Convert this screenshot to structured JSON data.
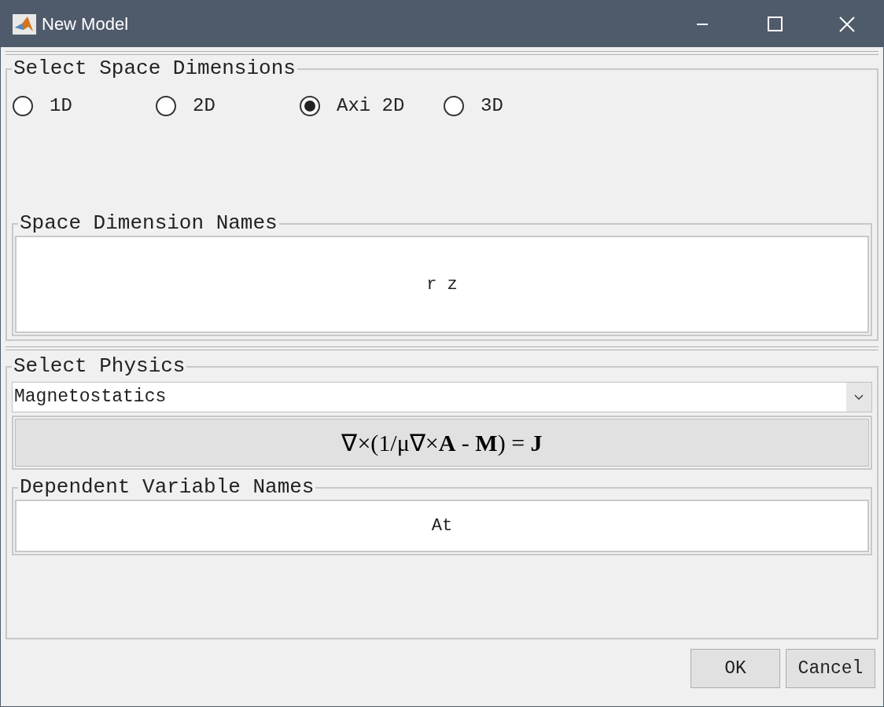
{
  "window": {
    "title": "New Model"
  },
  "space_dimensions": {
    "title": "Select Space Dimensions",
    "options": [
      {
        "label": "1D",
        "selected": false
      },
      {
        "label": "2D",
        "selected": false
      },
      {
        "label": "Axi 2D",
        "selected": true
      },
      {
        "label": "3D",
        "selected": false
      }
    ],
    "names": {
      "title": "Space Dimension Names",
      "value": "r z"
    }
  },
  "physics": {
    "title": "Select Physics",
    "dropdown": "Magnetostatics",
    "equation": "∇×(1/μ∇×**A** - **M**) = **J**",
    "dependent": {
      "title": "Dependent Variable Names",
      "value": "At"
    }
  },
  "buttons": [
    "OK",
    "Cancel"
  ]
}
